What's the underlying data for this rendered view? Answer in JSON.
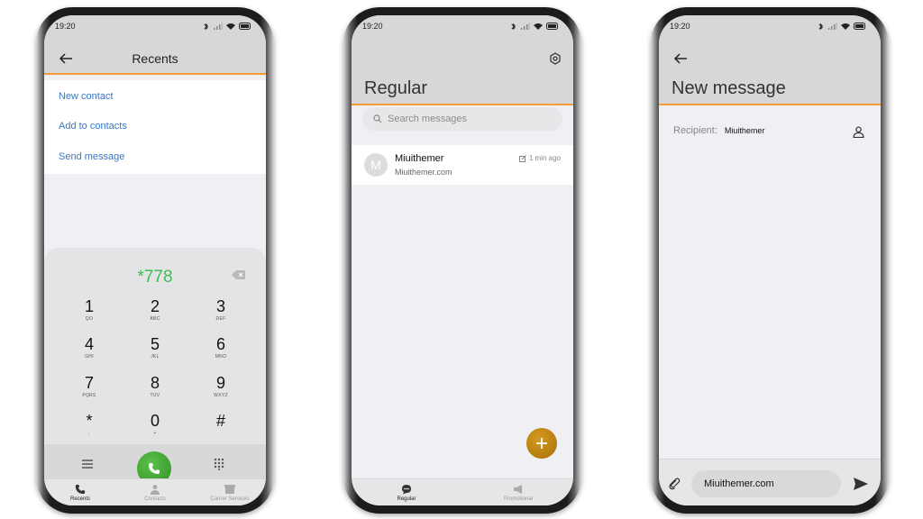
{
  "status": {
    "time": "19:20"
  },
  "recents_screen": {
    "title": "Recents",
    "menu": [
      "New contact",
      "Add to contacts",
      "Send message"
    ],
    "dialed_number": "*778",
    "keypad": [
      {
        "digit": "1",
        "letters": "QO"
      },
      {
        "digit": "2",
        "letters": "ABC"
      },
      {
        "digit": "3",
        "letters": "DEF"
      },
      {
        "digit": "4",
        "letters": "GHI"
      },
      {
        "digit": "5",
        "letters": "JKL"
      },
      {
        "digit": "6",
        "letters": "MNO"
      },
      {
        "digit": "7",
        "letters": "PQRS"
      },
      {
        "digit": "8",
        "letters": "TUV"
      },
      {
        "digit": "9",
        "letters": "WXYZ"
      },
      {
        "digit": "*",
        "letters": ","
      },
      {
        "digit": "0",
        "letters": "+"
      },
      {
        "digit": "#",
        "letters": ""
      }
    ],
    "tabs": [
      "Recents",
      "Contacts",
      "Carrier Services"
    ],
    "accent": "#f39c34",
    "call_color": "#3dbf52"
  },
  "messages_screen": {
    "title": "Regular",
    "search_placeholder": "Search messages",
    "conversation": {
      "avatar_letter": "M",
      "name": "Miuithemer",
      "preview": "Miuithemer.com",
      "time": "1 min ago"
    },
    "tabs": [
      "Regular",
      "Promotional"
    ],
    "fab_color": "#c28814"
  },
  "new_message_screen": {
    "title": "New message",
    "recipient_label": "Recipient:",
    "recipient_value": "Miuithemer",
    "message_text": "Miuithemer.com"
  }
}
